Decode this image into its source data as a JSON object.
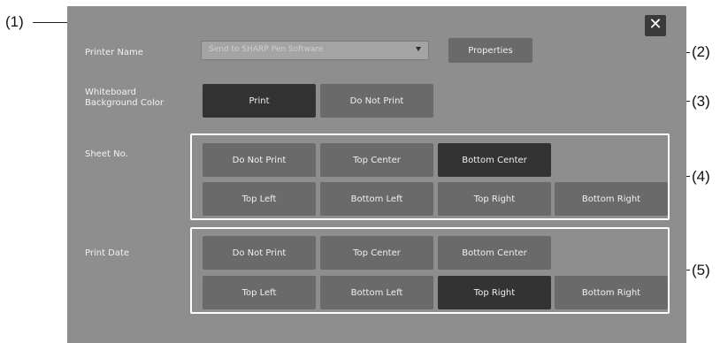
{
  "callouts": [
    "(1)",
    "(2)",
    "(3)",
    "(4)",
    "(5)"
  ],
  "close_label": "✕",
  "printer": {
    "label": "Printer Name",
    "selected": "Send to SHARP Pen Software",
    "properties_label": "Properties"
  },
  "background": {
    "label": "Whiteboard Background Color",
    "print_label": "Print",
    "do_not_print_label": "Do Not Print",
    "selected": "Print"
  },
  "sheet_no": {
    "label": "Sheet No.",
    "options": [
      "Do Not Print",
      "Top Center",
      "Bottom Center",
      "Top Left",
      "Bottom Left",
      "Top Right",
      "Bottom Right"
    ],
    "selected": "Bottom Center"
  },
  "print_date": {
    "label": "Print Date",
    "options": [
      "Do Not Print",
      "Top Center",
      "Bottom Center",
      "Top Left",
      "Bottom Left",
      "Top Right",
      "Bottom Right"
    ],
    "selected": "Top Right"
  },
  "colors": {
    "panel": "#8e8e8e",
    "button": "#6a6a6a",
    "button_selected": "#333333"
  }
}
